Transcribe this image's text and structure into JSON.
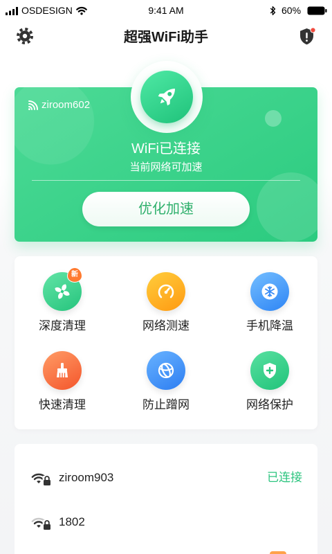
{
  "status_bar": {
    "carrier": "OSDESIGN",
    "time": "9:41 AM",
    "battery": "60%"
  },
  "header": {
    "title": "超强WiFi助手",
    "left_icon": "gear-icon",
    "right_icon": "shield-alert-icon"
  },
  "wifi_card": {
    "icon": "wifi-icon",
    "ssid": "ziroom602",
    "hero_icon": "rocket-icon",
    "status": "WiFi已连接",
    "subtitle": "当前网络可加速",
    "button_label": "优化加速"
  },
  "tools": [
    {
      "label": "深度清理",
      "icon": "fan-icon",
      "badge": "新",
      "color_from": "#62e4a6",
      "color_to": "#26c47d"
    },
    {
      "label": "网络测速",
      "icon": "speedometer-icon",
      "color_from": "#ffcd3c",
      "color_to": "#ff9a12"
    },
    {
      "label": "手机降温",
      "icon": "snowflake-icon",
      "color_from": "#74beff",
      "color_to": "#2e85f5"
    },
    {
      "label": "快速清理",
      "icon": "broom-icon",
      "color_from": "#ff9c66",
      "color_to": "#f4552b"
    },
    {
      "label": "防止蹭网",
      "icon": "globe-icon",
      "color_from": "#68b2ff",
      "color_to": "#2d7ef2"
    },
    {
      "label": "网络保护",
      "icon": "shield-plus-icon",
      "color_from": "#58e0a0",
      "color_to": "#21c37a"
    }
  ],
  "networks": [
    {
      "ssid": "ziroom903",
      "status": "已连接",
      "icon": "wifi-lock-icon",
      "signal_bars": 3
    },
    {
      "ssid": "1802",
      "icon": "wifi-lock-icon",
      "signal_bars": 2
    }
  ],
  "colors": {
    "card_gradient": {
      "color_from": "#4cda96",
      "color_to": "#2bcb7f"
    },
    "hero_gradient": {
      "color_from": "#4fe9a5",
      "color_to": "#1fc27a"
    },
    "button_text": "#2fb06c",
    "connected_text": "#2dc47f",
    "badge": "#ff7a30",
    "alert_dot": "#f04a3e"
  }
}
